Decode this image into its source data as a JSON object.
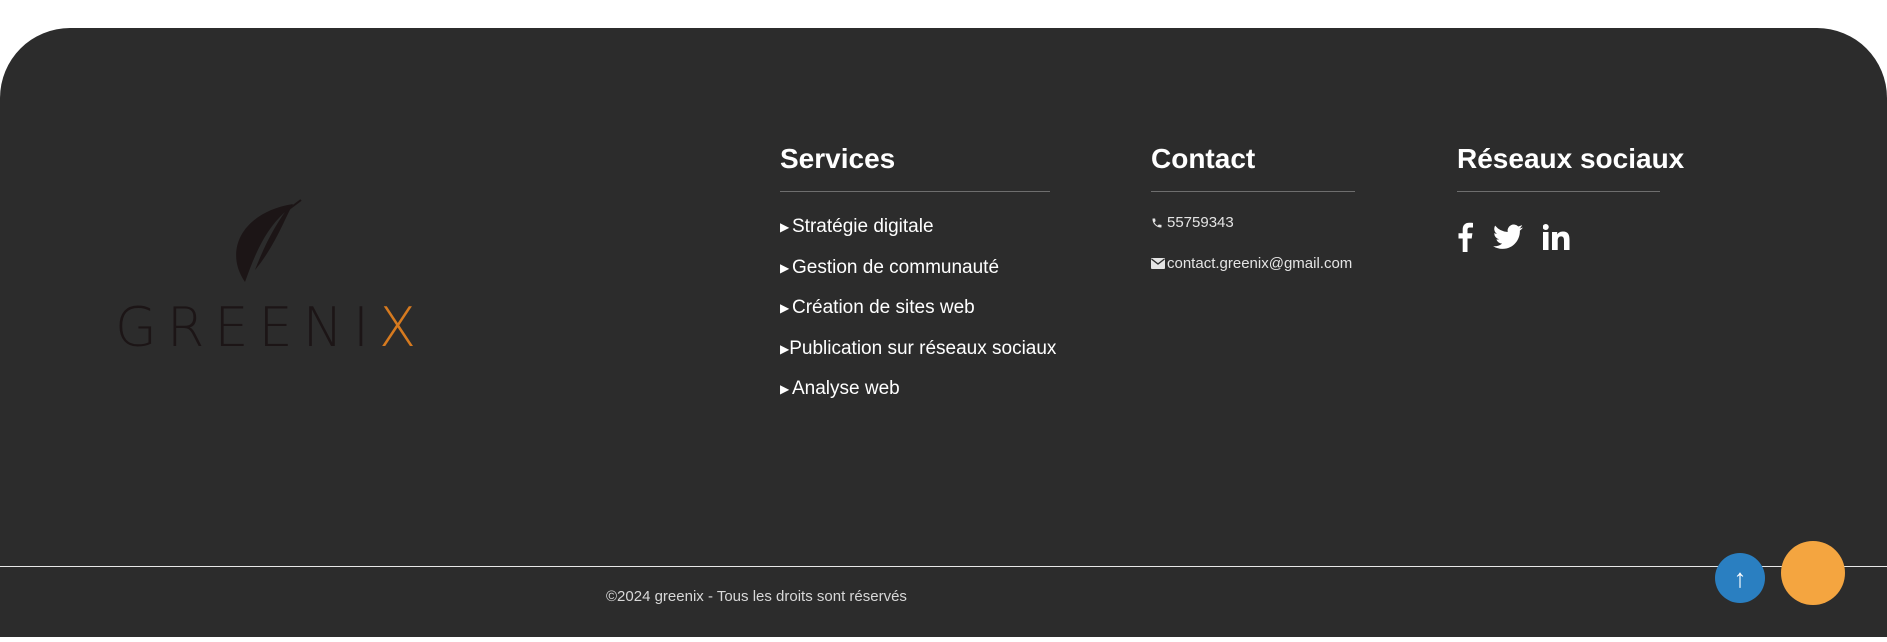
{
  "brand": {
    "logo_text_dark": "GREENI",
    "logo_text_accent": "X",
    "accent_color": "#d67a1f",
    "dark_color": "#1c1516"
  },
  "services": {
    "title": "Services",
    "items": [
      "Stratégie digitale",
      "Gestion de communauté",
      "Création de sites web",
      "Publication sur réseaux sociaux",
      "Analyse web"
    ]
  },
  "contact": {
    "title": "Contact",
    "phone": "55759343",
    "phone_icon": "phone-icon",
    "email": "contact.greenix@gmail.com",
    "email_icon": "envelope-icon"
  },
  "social": {
    "title": "Réseaux sociaux",
    "icons": [
      "facebook-icon",
      "twitter-icon",
      "linkedin-icon"
    ]
  },
  "footer": {
    "copyright": "©2024 greenix - Tous les droits sont réservés",
    "background": "#2c2c2c"
  },
  "floating": {
    "scroll_top_label": "↑",
    "scroll_top_color": "#2a7fc1",
    "orange_button_color": "#f4a540"
  }
}
